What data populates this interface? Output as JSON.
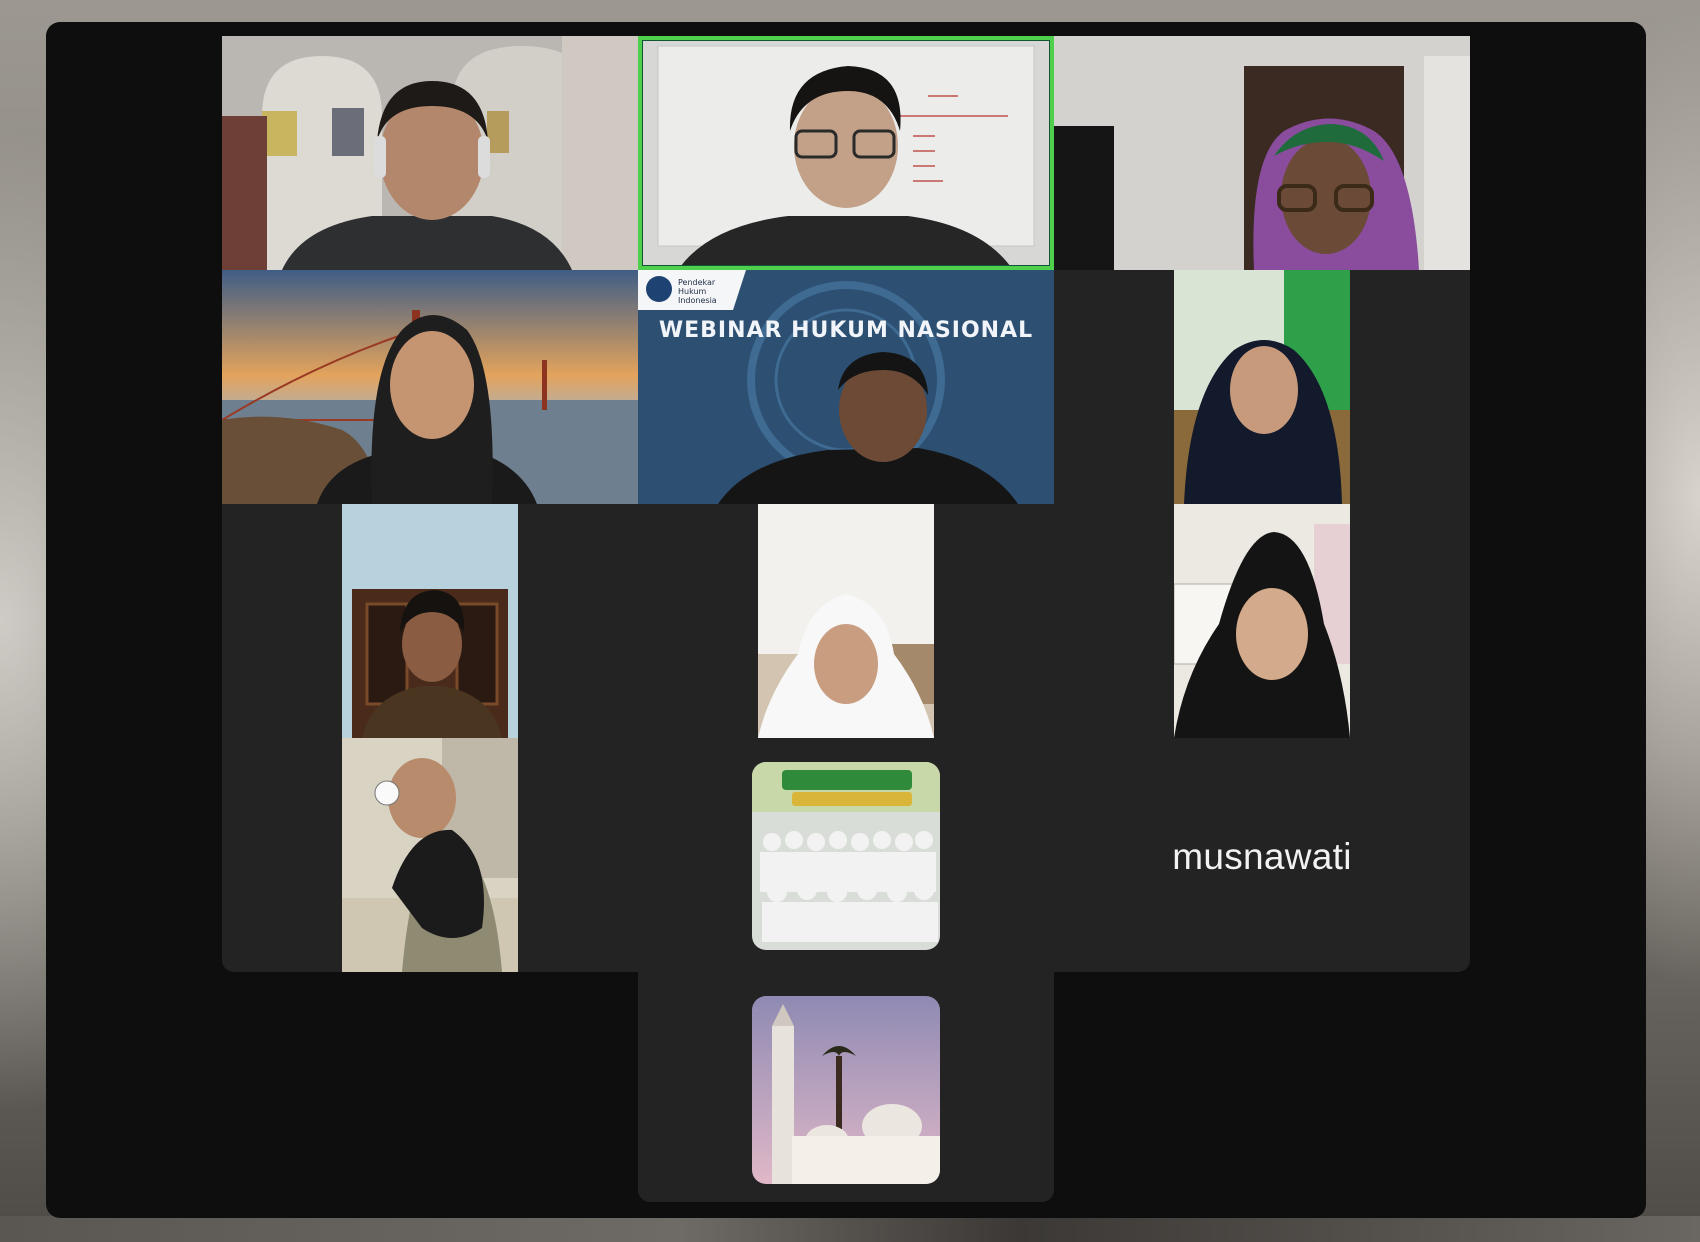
{
  "window": {
    "title": ""
  },
  "participants": [
    {
      "id": "p1",
      "icon": "video-feed-man-headphones"
    },
    {
      "id": "p2",
      "icon": "video-feed-speaker-whiteboard",
      "active_speaker": true
    },
    {
      "id": "p3",
      "icon": "video-feed-woman-purple-hijab"
    },
    {
      "id": "p4",
      "icon": "video-feed-woman-golden-gate-background"
    },
    {
      "id": "p5",
      "icon": "video-feed-webinar-background"
    },
    {
      "id": "p6",
      "icon": "video-feed-woman-green-room"
    },
    {
      "id": "p7",
      "icon": "video-feed-man-cabinet"
    },
    {
      "id": "p8",
      "icon": "video-feed-woman-white-hijab"
    },
    {
      "id": "p9",
      "icon": "video-feed-woman-calendar"
    },
    {
      "id": "p10",
      "icon": "video-feed-baby"
    },
    {
      "id": "p11",
      "icon": "avatar-group-photo"
    },
    {
      "id": "p12",
      "icon": "avatar-mosque"
    },
    {
      "id": "p13",
      "name": "musnawati"
    }
  ],
  "webinar": {
    "title": "WEBINAR HUKUM NASIONAL",
    "org_name": "Pendekar Hukum Indonesia"
  },
  "colors": {
    "active_speaker_border": "#4fd04c",
    "tile_background": "#232323",
    "window_background": "#0e0e0e",
    "webinar_blue": "#2c4f72"
  }
}
